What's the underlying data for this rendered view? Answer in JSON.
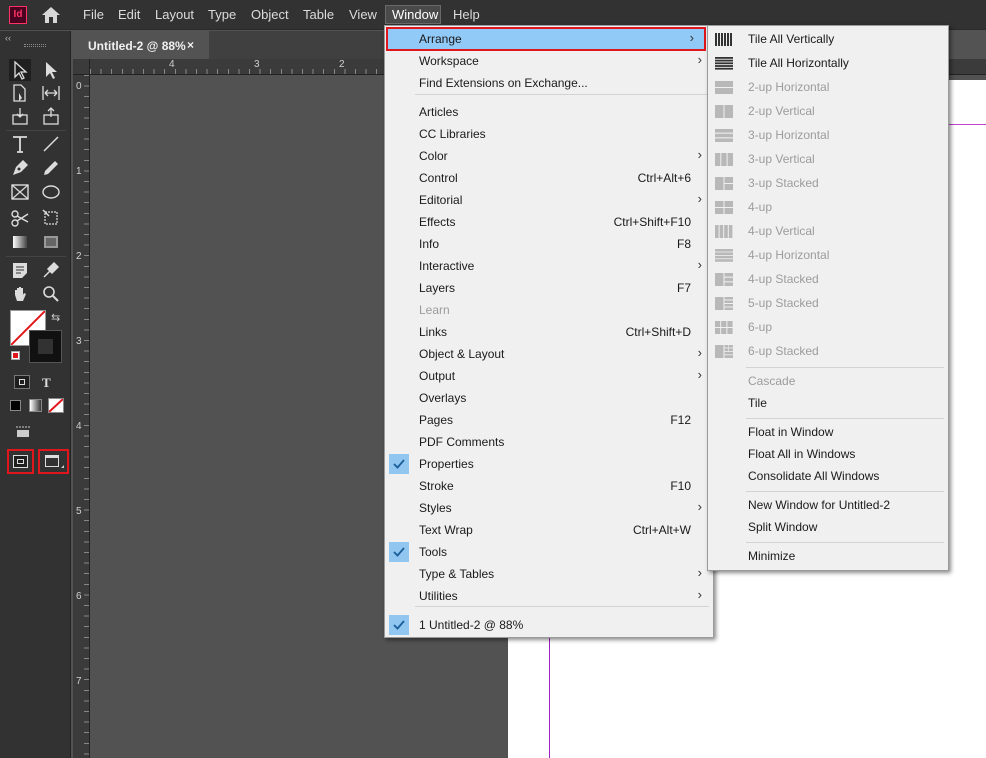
{
  "app": {
    "logo_text": "Id"
  },
  "menubar": {
    "items": [
      "File",
      "Edit",
      "Layout",
      "Type",
      "Object",
      "Table",
      "View",
      "Window",
      "Help"
    ]
  },
  "document": {
    "tab_title": "Untitled-2 @ 88%",
    "tab_close": "×",
    "ruler_top_labels": [
      "4",
      "3",
      "2"
    ],
    "ruler_left_labels": [
      "0",
      "1",
      "2",
      "3",
      "4",
      "5",
      "6",
      "7"
    ]
  },
  "window_menu": {
    "items": [
      {
        "label": "Arrange",
        "shortcut": "",
        "submenu": true,
        "highlighted": true
      },
      {
        "label": "Workspace",
        "shortcut": "",
        "submenu": true
      },
      {
        "label": "Find Extensions on Exchange...",
        "shortcut": "",
        "submenu": false
      },
      {
        "label": "Articles",
        "shortcut": "",
        "submenu": false
      },
      {
        "label": "CC Libraries",
        "shortcut": "",
        "submenu": false
      },
      {
        "label": "Color",
        "shortcut": "",
        "submenu": true
      },
      {
        "label": "Control",
        "shortcut": "Ctrl+Alt+6",
        "submenu": false
      },
      {
        "label": "Editorial",
        "shortcut": "",
        "submenu": true
      },
      {
        "label": "Effects",
        "shortcut": "Ctrl+Shift+F10",
        "submenu": false
      },
      {
        "label": "Info",
        "shortcut": "F8",
        "submenu": false
      },
      {
        "label": "Interactive",
        "shortcut": "",
        "submenu": true
      },
      {
        "label": "Layers",
        "shortcut": "F7",
        "submenu": false
      },
      {
        "label": "Learn",
        "shortcut": "",
        "submenu": false,
        "disabled": true
      },
      {
        "label": "Links",
        "shortcut": "Ctrl+Shift+D",
        "submenu": false
      },
      {
        "label": "Object & Layout",
        "shortcut": "",
        "submenu": true
      },
      {
        "label": "Output",
        "shortcut": "",
        "submenu": true
      },
      {
        "label": "Overlays",
        "shortcut": "",
        "submenu": false
      },
      {
        "label": "Pages",
        "shortcut": "F12",
        "submenu": false
      },
      {
        "label": "PDF Comments",
        "shortcut": "",
        "submenu": false
      },
      {
        "label": "Properties",
        "shortcut": "",
        "submenu": false,
        "checked": true
      },
      {
        "label": "Stroke",
        "shortcut": "F10",
        "submenu": false
      },
      {
        "label": "Styles",
        "shortcut": "",
        "submenu": true
      },
      {
        "label": "Text Wrap",
        "shortcut": "Ctrl+Alt+W",
        "submenu": false
      },
      {
        "label": "Tools",
        "shortcut": "",
        "submenu": false,
        "checked": true
      },
      {
        "label": "Type & Tables",
        "shortcut": "",
        "submenu": true
      },
      {
        "label": "Utilities",
        "shortcut": "",
        "submenu": true
      },
      {
        "label": "1 Untitled-2 @ 88%",
        "shortcut": "",
        "submenu": false,
        "checked": true
      }
    ]
  },
  "arrange_menu": {
    "items": [
      {
        "label": "Tile All Vertically",
        "icon": "tile-vertical-icon"
      },
      {
        "label": "Tile All Horizontally",
        "icon": "tile-horizontal-icon"
      },
      {
        "label": "2-up Horizontal",
        "icon": "2up-horizontal-icon",
        "disabled": true
      },
      {
        "label": "2-up Vertical",
        "icon": "2up-vertical-icon",
        "disabled": true
      },
      {
        "label": "3-up Horizontal",
        "icon": "3up-horizontal-icon",
        "disabled": true
      },
      {
        "label": "3-up Vertical",
        "icon": "3up-vertical-icon",
        "disabled": true
      },
      {
        "label": "3-up Stacked",
        "icon": "3up-stacked-icon",
        "disabled": true
      },
      {
        "label": "4-up",
        "icon": "4up-icon",
        "disabled": true
      },
      {
        "label": "4-up Vertical",
        "icon": "4up-vertical-icon",
        "disabled": true
      },
      {
        "label": "4-up Horizontal",
        "icon": "4up-horizontal-icon",
        "disabled": true
      },
      {
        "label": "4-up Stacked",
        "icon": "4up-stacked-icon",
        "disabled": true
      },
      {
        "label": "5-up Stacked",
        "icon": "5up-stacked-icon",
        "disabled": true
      },
      {
        "label": "6-up",
        "icon": "6up-icon",
        "disabled": true
      },
      {
        "label": "6-up Stacked",
        "icon": "6up-stacked-icon",
        "disabled": true
      },
      {
        "label": "Cascade",
        "disabled": true
      },
      {
        "label": "Tile"
      },
      {
        "label": "Float in Window"
      },
      {
        "label": "Float All in Windows"
      },
      {
        "label": "Consolidate All Windows"
      },
      {
        "label": "New Window for Untitled-2"
      },
      {
        "label": "Split Window"
      },
      {
        "label": "Minimize"
      }
    ]
  },
  "tools_panel": {
    "type_label": "T"
  },
  "colors": {
    "highlight": "#91c9f7",
    "check_bg": "#90c6ef",
    "annotation_red": "#e0161d",
    "app_logo": "#ff3366"
  }
}
